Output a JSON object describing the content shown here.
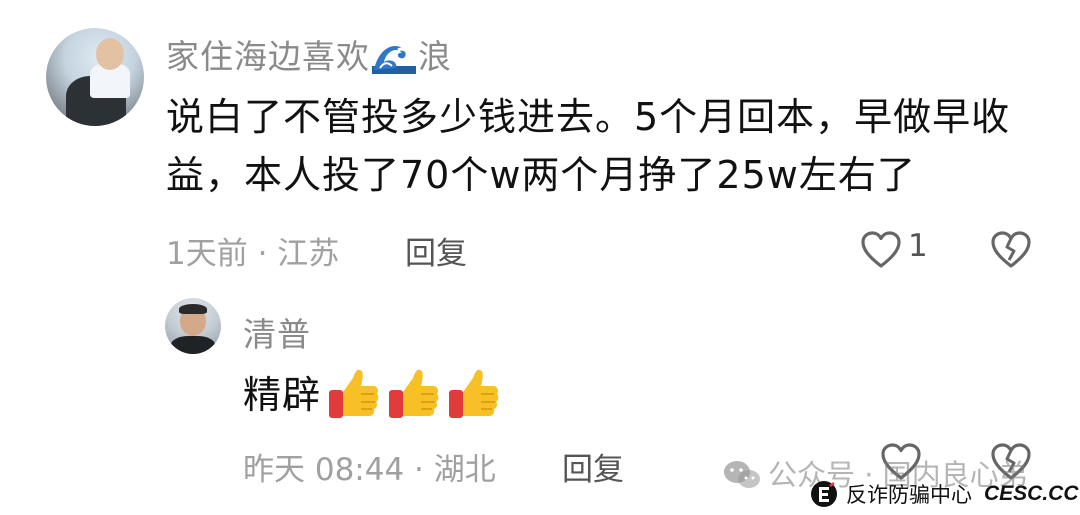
{
  "comments": [
    {
      "username_prefix": "家住海边喜欢",
      "username_emoji": "wave-emoji",
      "username_suffix": "浪",
      "text": "说白了不管投多少钱进去。5个月回本，早做早收益，本人投了70个w两个月挣了25w左右了",
      "time": "1天前 · 江苏",
      "reply_label": "回复",
      "likes": "1"
    },
    {
      "username": "清普",
      "text": "精辟",
      "emoji": [
        "thumbs-up-emoji",
        "thumbs-up-emoji",
        "thumbs-up-emoji"
      ],
      "time": "昨天 08:44 · 湖北",
      "reply_label": "回复"
    }
  ],
  "watermark": {
    "public_account": "公众号 · 国内良心弟",
    "brand_cn": "反诈防骗中心",
    "brand_en": "CESC.CC"
  },
  "colors": {
    "username": "#8a8a8a",
    "meta": "#a0a0a0",
    "text": "#111111",
    "thumb_yellow": "#f6c026",
    "thumb_cuff": "#e23b3b"
  }
}
